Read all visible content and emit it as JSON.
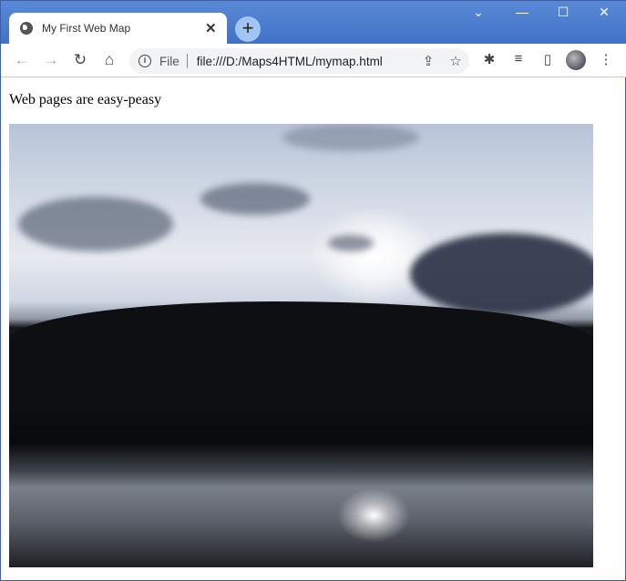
{
  "browser": {
    "tab_title": "My First Web Map",
    "tab_close": "✕",
    "new_tab": "+",
    "window_controls": {
      "tab_search": "⌄",
      "minimize": "—",
      "maximize": "☐",
      "close": "✕"
    },
    "nav": {
      "back": "←",
      "forward": "→",
      "reload": "↻",
      "home": "⌂"
    },
    "omnibox": {
      "info": "i",
      "scheme_label": "File",
      "url": "file:///D:/Maps4HTML/mymap.html",
      "share": "⇪",
      "bookmark": "☆"
    },
    "toolbar_icons": {
      "extensions": "✱",
      "media": "≡",
      "side_panel": "▯",
      "menu": "⋮"
    }
  },
  "page": {
    "heading": "Web pages are easy-peasy",
    "image_description_icon": "photo-sunset-lake"
  }
}
